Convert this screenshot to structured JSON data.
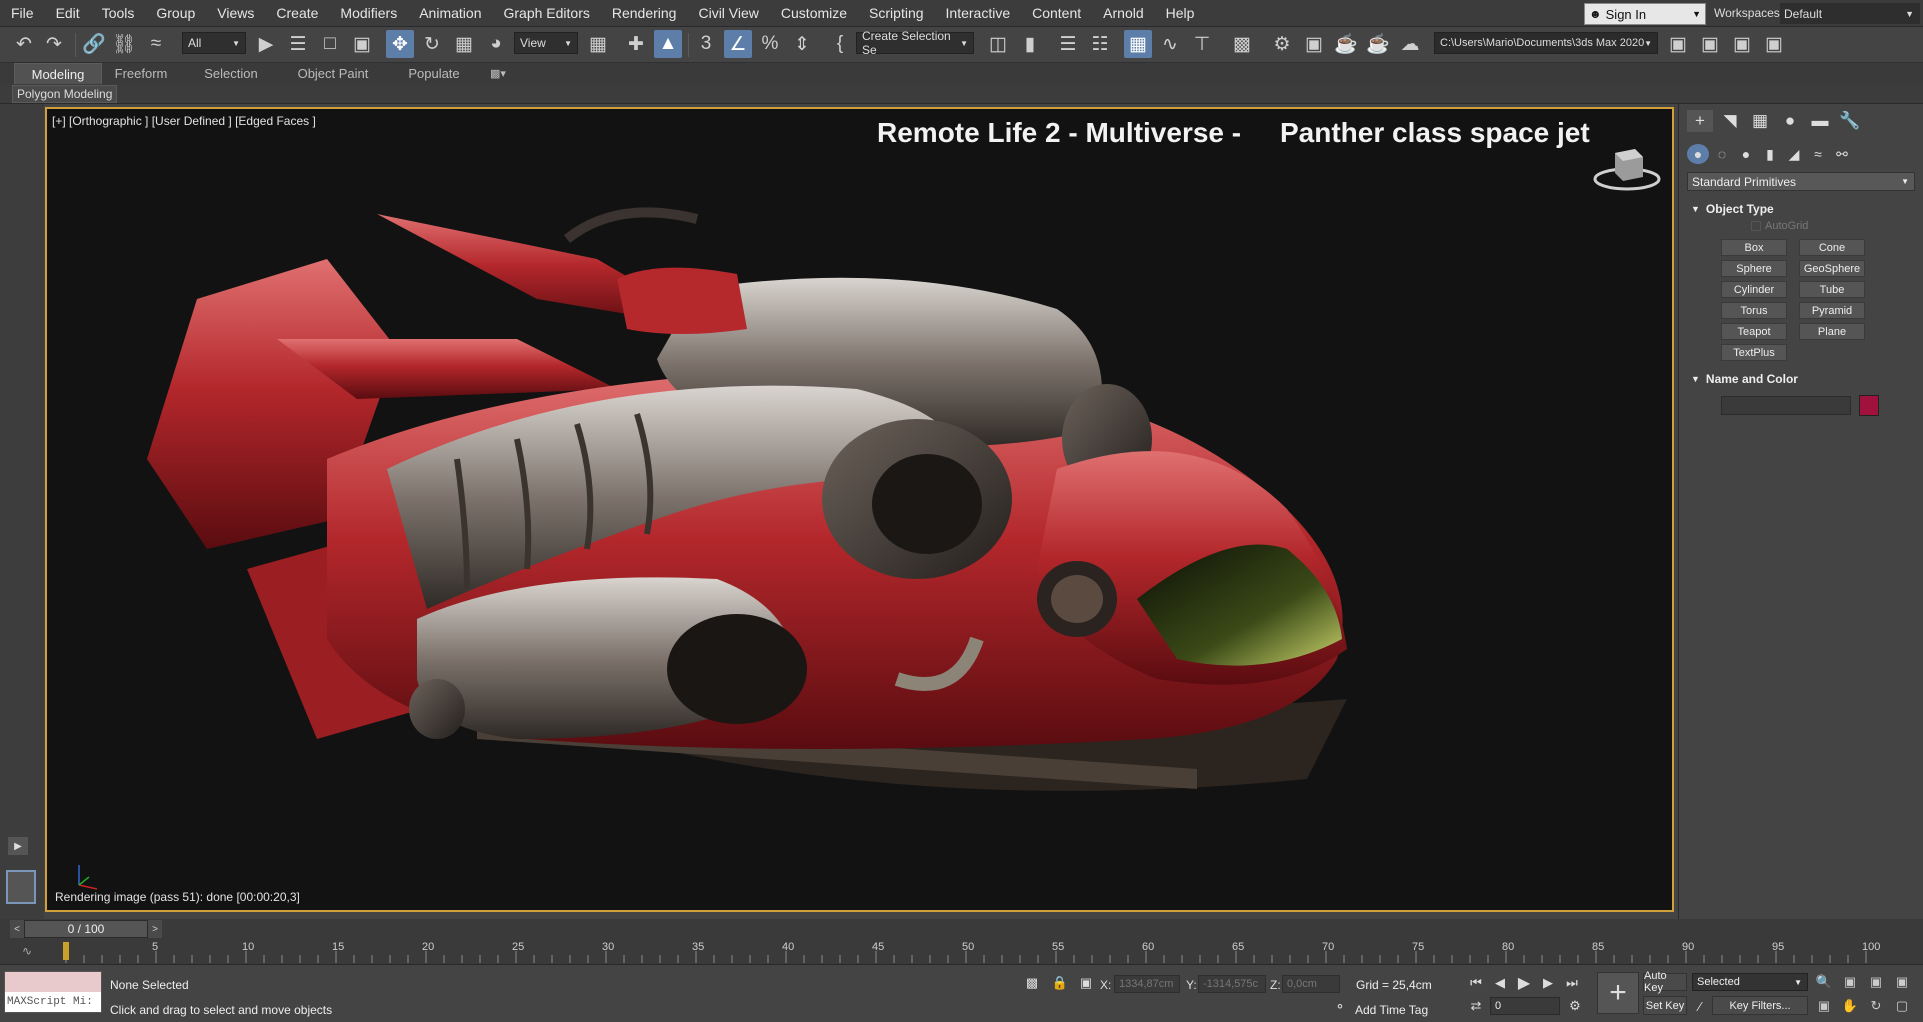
{
  "menubar": {
    "items": [
      "File",
      "Edit",
      "Tools",
      "Group",
      "Views",
      "Create",
      "Modifiers",
      "Animation",
      "Graph Editors",
      "Rendering",
      "Civil View",
      "Customize",
      "Scripting",
      "Interactive",
      "Content",
      "Arnold",
      "Help"
    ],
    "signin_label": "Sign In",
    "workspaces_label": "Workspaces:",
    "workspace_value": "Default"
  },
  "toolbar": {
    "selection_filter": "All",
    "ref_coord": "View",
    "named_selection": "Create Selection Se",
    "project_path": "C:\\Users\\Mario\\Documents\\3ds Max 2020"
  },
  "ribbon": {
    "tabs": [
      "Modeling",
      "Freeform",
      "Selection",
      "Object Paint",
      "Populate"
    ],
    "active_tab": "Modeling",
    "panel_label": "Polygon Modeling"
  },
  "viewport": {
    "label": "[+] [Orthographic ] [User Defined ] [Edged Faces ]",
    "title": "Remote Life 2 - Multiverse -     Panther class space jet",
    "render_status": "Rendering image (pass 51): done [00:00:20,3]",
    "border_color": "#d2a03a"
  },
  "command_panel": {
    "primitive_type": "Standard Primitives",
    "object_type_header": "Object Type",
    "autogrid_label": "AutoGrid",
    "buttons": [
      "Box",
      "Cone",
      "Sphere",
      "GeoSphere",
      "Cylinder",
      "Tube",
      "Torus",
      "Pyramid",
      "Teapot",
      "Plane",
      "TextPlus"
    ],
    "name_color_header": "Name and Color",
    "object_color": "#a0113d"
  },
  "timeline": {
    "frame_counter": "0 / 100",
    "ruler_ticks": [
      "5",
      "10",
      "15",
      "20",
      "25",
      "30",
      "35",
      "40",
      "45",
      "50",
      "55",
      "60",
      "65",
      "70",
      "75",
      "80",
      "85",
      "90",
      "95",
      "100"
    ]
  },
  "status": {
    "maxscript_text": "MAXScript Mi:",
    "selection_text": "None Selected",
    "prompt_text": "Click and drag to select and move objects",
    "x_label": "X:",
    "x_value": "1334,87cm",
    "y_label": "Y:",
    "y_value": "-1314,575c",
    "z_label": "Z:",
    "z_value": "0,0cm",
    "grid_text": "Grid = 25,4cm",
    "add_time_tag": "Add Time Tag",
    "current_frame": "0",
    "auto_key": "Auto Key",
    "set_key": "Set Key",
    "key_mode": "Selected",
    "key_filters": "Key Filters..."
  }
}
